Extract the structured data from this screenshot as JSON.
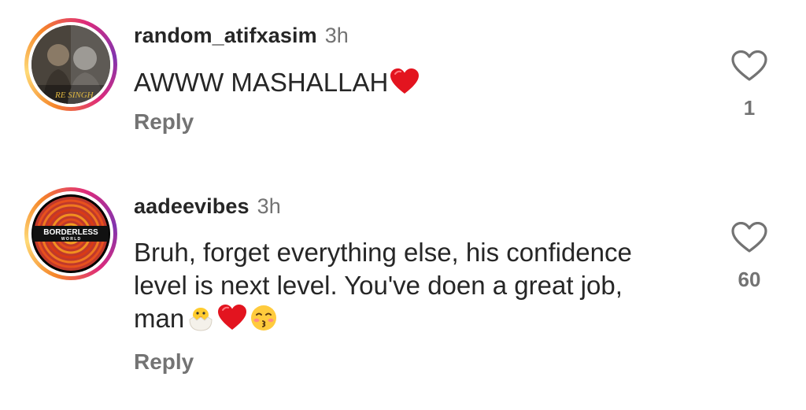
{
  "comments": [
    {
      "username": "random_atifxasim",
      "time": "3h",
      "text": "AWWW MASHALLAH",
      "reply_label": "Reply",
      "likes": "1",
      "avatar_icon": "profile-photo-two-men",
      "emoji_icons": [
        "red-heart-emoji"
      ]
    },
    {
      "username": "aadeevibes",
      "time": "3h",
      "text_lines": [
        "Bruh, forget everything else, his confidence",
        "level is next level. You've doen a great job,",
        "man"
      ],
      "reply_label": "Reply",
      "likes": "60",
      "avatar_icon": "borderless-world-logo",
      "avatar_text": "BORDERLESS",
      "avatar_subtext": "W O R L D",
      "emoji_icons": [
        "hatching-chick-emoji",
        "red-heart-emoji",
        "kissing-face-emoji"
      ]
    }
  ],
  "colors": {
    "text": "#262626",
    "secondary": "#737373",
    "heart_red": "#e3141f",
    "story_ring_start": "#f58529",
    "story_ring_end": "#8134af"
  }
}
